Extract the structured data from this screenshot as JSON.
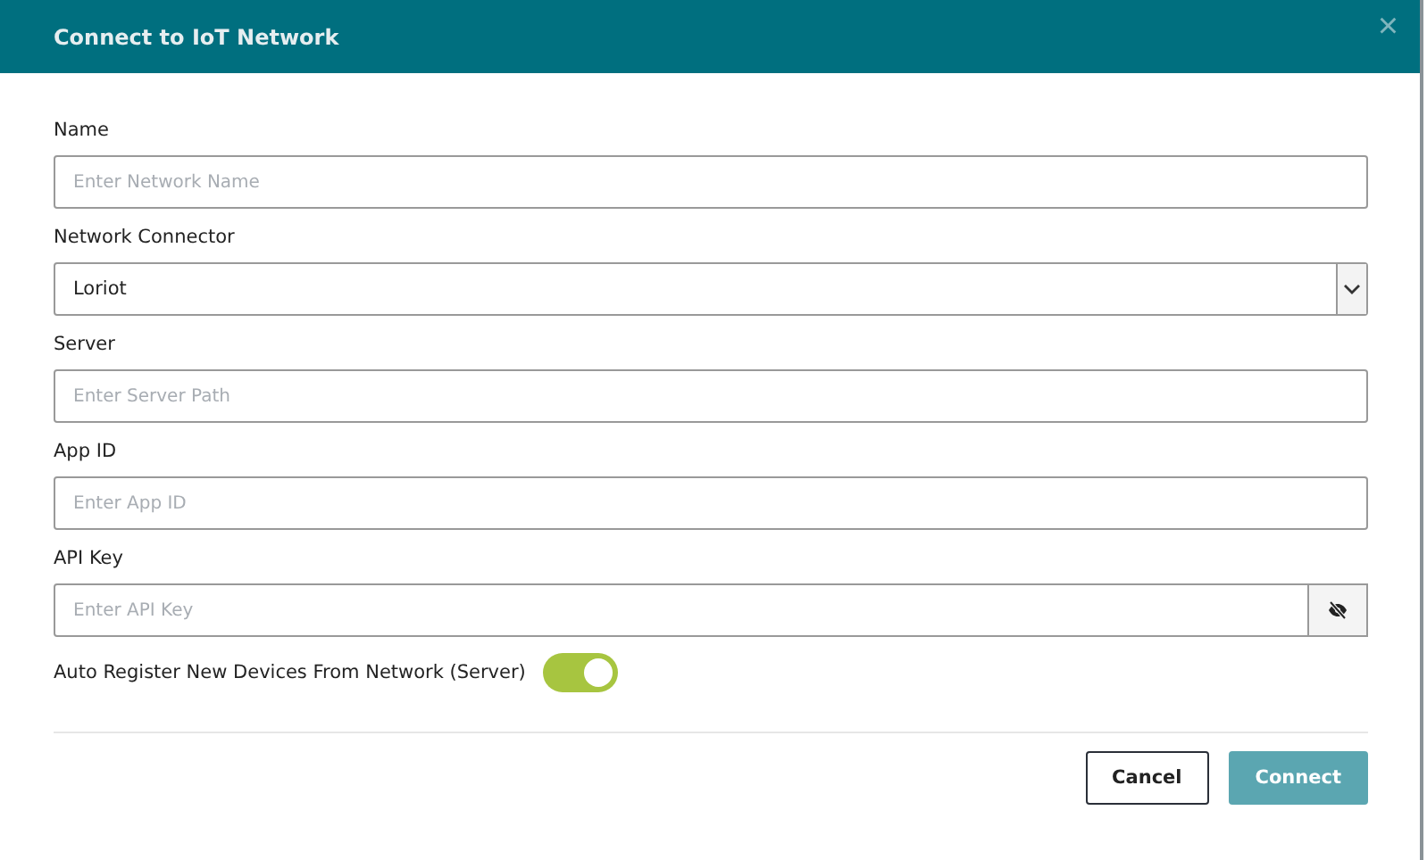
{
  "dialog": {
    "title": "Connect to IoT Network",
    "close": "×"
  },
  "fields": [
    {
      "kind": "text",
      "label": "Name",
      "placeholder": "Enter Network Name"
    },
    {
      "kind": "select",
      "label": "Network Connector",
      "value": "Loriot"
    },
    {
      "kind": "text",
      "label": "Server",
      "placeholder": "Enter Server Path"
    },
    {
      "kind": "text",
      "label": "App ID",
      "placeholder": "Enter App ID"
    },
    {
      "kind": "password",
      "label": "API Key",
      "placeholder": "Enter API Key"
    }
  ],
  "toggle": {
    "label": "Auto Register New Devices From Network (Server)",
    "on": true
  },
  "buttons": [
    {
      "kind": "secondary",
      "label": "Cancel",
      "disabled": false
    },
    {
      "kind": "primary",
      "label": "Connect",
      "disabled": true
    }
  ]
}
